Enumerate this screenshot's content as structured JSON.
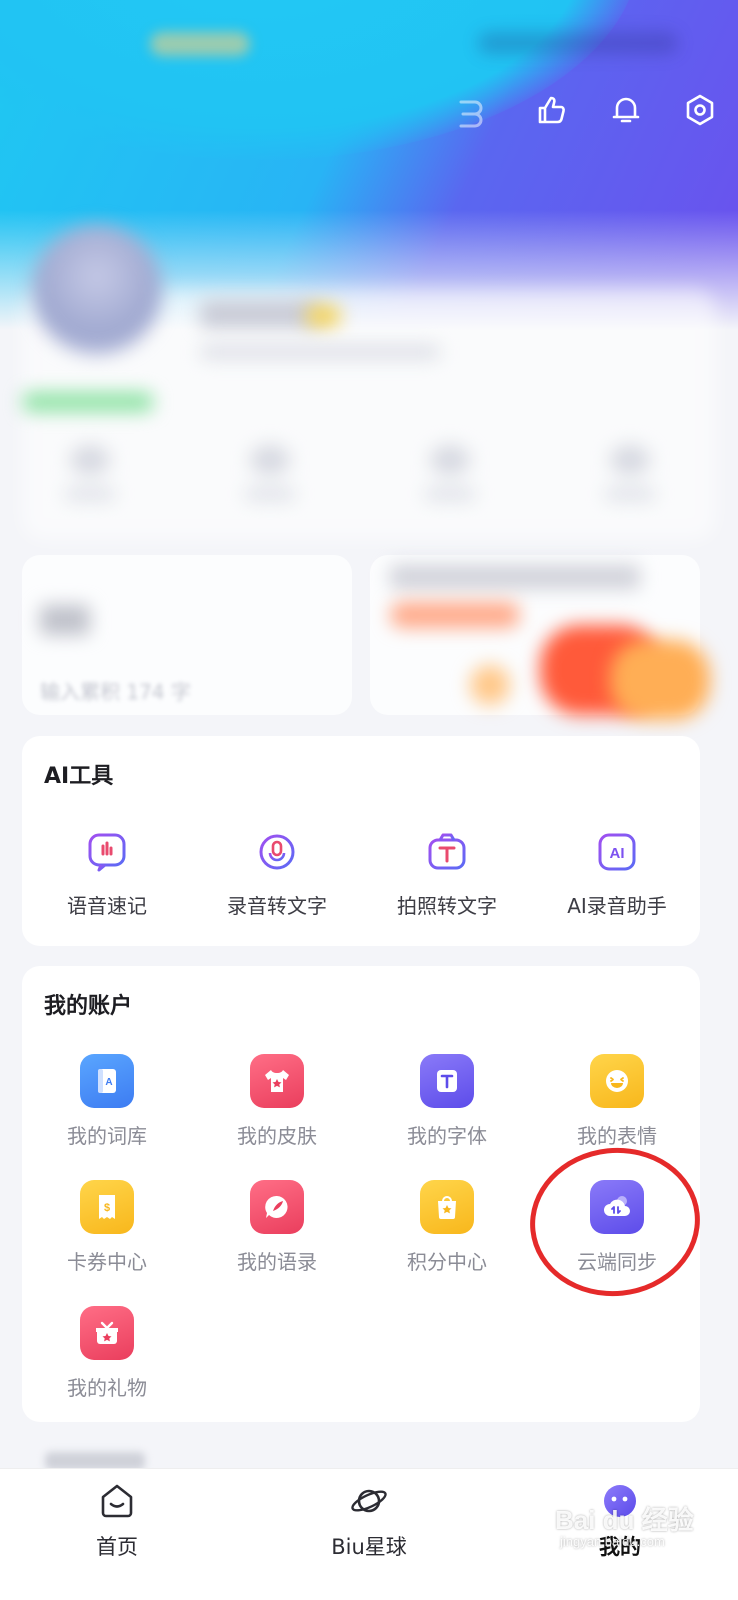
{
  "header": {
    "icons": [
      "like-icon",
      "bell-icon",
      "settings-icon"
    ]
  },
  "profile": {
    "promo_left_text": "输入累积 174 字"
  },
  "ai_tools": {
    "title": "AI工具",
    "items": [
      {
        "label": "语音速记",
        "icon": "voice-note-icon"
      },
      {
        "label": "录音转文字",
        "icon": "recording-to-text-icon"
      },
      {
        "label": "拍照转文字",
        "icon": "photo-to-text-icon"
      },
      {
        "label": "AI录音助手",
        "icon": "ai-recording-assistant-icon"
      }
    ]
  },
  "account": {
    "title": "我的账户",
    "items": [
      {
        "label": "我的词库",
        "icon": "dictionary-icon",
        "color": "#3f8cf8"
      },
      {
        "label": "我的皮肤",
        "icon": "skin-icon",
        "color": "#f0506c"
      },
      {
        "label": "我的字体",
        "icon": "font-icon",
        "color": "#6c5cf2"
      },
      {
        "label": "我的表情",
        "icon": "emoji-icon",
        "color": "#fbc52d"
      },
      {
        "label": "卡券中心",
        "icon": "coupon-icon",
        "color": "#fbc52d"
      },
      {
        "label": "我的语录",
        "icon": "quotes-icon",
        "color": "#f0506c"
      },
      {
        "label": "积分中心",
        "icon": "points-icon",
        "color": "#fbc52d"
      },
      {
        "label": "云端同步",
        "icon": "cloud-sync-icon",
        "color": "#6c5cf2"
      },
      {
        "label": "我的礼物",
        "icon": "gift-icon",
        "color": "#f0506c"
      }
    ]
  },
  "bottom_nav": {
    "items": [
      {
        "label": "首页",
        "icon": "home-icon"
      },
      {
        "label": "Biu星球",
        "icon": "planet-icon"
      },
      {
        "label": "我的",
        "icon": "me-icon",
        "active": true
      }
    ]
  },
  "watermark": {
    "text": "Bai du 经验",
    "sub": "jingyan.baidu.com"
  },
  "colors": {
    "accent_purple": "#6c5cf2",
    "highlight_red": "#e52a2a"
  }
}
